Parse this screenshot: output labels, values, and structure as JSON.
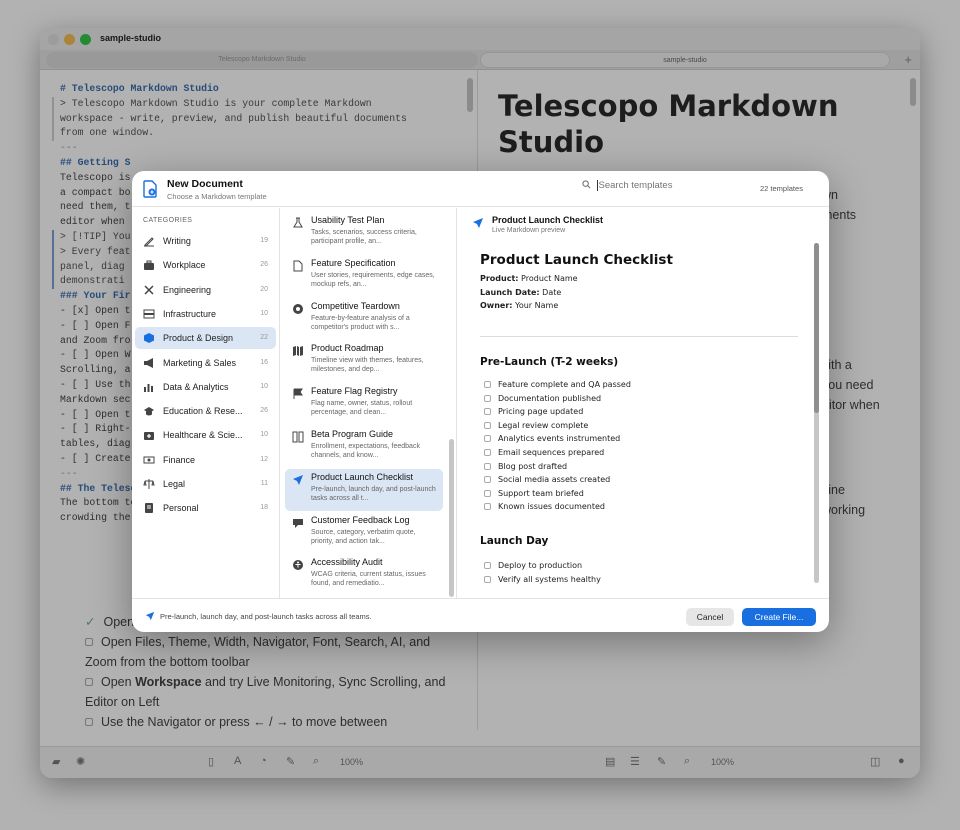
{
  "window": {
    "title": "sample-studio",
    "tabs": [
      {
        "label": "Telescopo Markdown Studio"
      },
      {
        "label": "sample-studio"
      }
    ]
  },
  "editor": {
    "lines": [
      "# Telescopo Markdown Studio",
      "",
      "> Telescopo Markdown Studio is your complete Markdown",
      "workspace - write, preview, and publish beautiful documents",
      "from one window.",
      "",
      "---",
      "",
      "## Getting S",
      "",
      "Telescopo is",
      "a compact bo",
      "need them, t",
      "editor when",
      "",
      "> [!TIP] You",
      "> Every feat",
      "panel, diag",
      "demonstrati",
      "",
      "### Your Fir",
      "",
      "- [x] Open t",
      "- [ ] Open F",
      "and Zoom fro",
      "- [ ] Open W",
      "Scrolling, a",
      "- [ ] Use th",
      "Markdown sec",
      "- [ ] Open t",
      "- [ ] Right-",
      "tables, diag",
      "- [ ] Create",
      "",
      "---",
      "",
      "## The Telescopo Bottom Toolbar",
      "",
      "The bottom toolbar keeps document tools visible without",
      "crowding the reading surface."
    ]
  },
  "preview": {
    "heading": "Telescopo Markdown Studio",
    "fragments": [
      "wn",
      "ments",
      "vith a",
      "you need",
      "ditor when",
      "tline",
      "working"
    ],
    "checklist": [
      {
        "checked": true,
        "text": "Open this guide"
      },
      {
        "checked": false,
        "text": "Open Files, Theme, Width, Navigator, Font, Search, AI, and Zoom from the bottom toolbar"
      },
      {
        "checked": false,
        "text_before": "Open ",
        "bold": "Workspace",
        "text_after": " and try Live Monitoring, Sync Scrolling, and Editor on Left"
      },
      {
        "checked": false,
        "text": "Use the Navigator or press ← / → to move between"
      }
    ]
  },
  "bottombar": {
    "left_zoom": "100%",
    "right_zoom": "100%"
  },
  "modal": {
    "title": "New Document",
    "subtitle": "Choose a Markdown template",
    "search_placeholder": "Search templates",
    "count": "22 templates",
    "categories_heading": "CATEGORIES",
    "categories": [
      {
        "label": "Writing",
        "count": "19",
        "icon": "pen-icon"
      },
      {
        "label": "Workplace",
        "count": "26",
        "icon": "briefcase-icon"
      },
      {
        "label": "Engineering",
        "count": "20",
        "icon": "wrench-icon"
      },
      {
        "label": "Infrastructure",
        "count": "10",
        "icon": "server-icon"
      },
      {
        "label": "Product & Design",
        "count": "22",
        "icon": "cube-icon"
      },
      {
        "label": "Marketing & Sales",
        "count": "16",
        "icon": "megaphone-icon"
      },
      {
        "label": "Data & Analytics",
        "count": "10",
        "icon": "bar-chart-icon"
      },
      {
        "label": "Education & Rese...",
        "count": "26",
        "icon": "graduation-cap-icon"
      },
      {
        "label": "Healthcare & Scie...",
        "count": "10",
        "icon": "medical-kit-icon"
      },
      {
        "label": "Finance",
        "count": "12",
        "icon": "banknote-icon"
      },
      {
        "label": "Legal",
        "count": "11",
        "icon": "scales-icon"
      },
      {
        "label": "Personal",
        "count": "18",
        "icon": "notebook-icon"
      }
    ],
    "selected_category": "Product & Design",
    "templates": [
      {
        "title": "Usability Test Plan",
        "desc": "Tasks, scenarios, success criteria, participant profile, an...",
        "icon": "flask-icon"
      },
      {
        "title": "Feature Specification",
        "desc": "User stories, requirements, edge cases, mockup refs, an...",
        "icon": "doc-icon"
      },
      {
        "title": "Competitive Teardown",
        "desc": "Feature-by-feature analysis of a competitor's product with s...",
        "icon": "target-icon"
      },
      {
        "title": "Product Roadmap",
        "desc": "Timeline view with themes, features, milestones, and dep...",
        "icon": "map-icon"
      },
      {
        "title": "Feature Flag Registry",
        "desc": "Flag name, owner, status, rollout percentage, and clean...",
        "icon": "flag-icon"
      },
      {
        "title": "Beta Program Guide",
        "desc": "Enrollment, expectations, feedback channels, and know...",
        "icon": "book-icon"
      },
      {
        "title": "Product Launch Checklist",
        "desc": "Pre-launch, launch day, and post-launch tasks across all t...",
        "icon": "paper-plane-icon"
      },
      {
        "title": "Customer Feedback Log",
        "desc": "Source, category, verbatim quote, priority, and action tak...",
        "icon": "chat-icon"
      },
      {
        "title": "Accessibility Audit",
        "desc": "WCAG criteria, current status, issues found, and remediatio...",
        "icon": "accessibility-icon"
      }
    ],
    "selected_template": "Product Launch Checklist",
    "preview_header": {
      "title": "Product Launch Checklist",
      "subtitle": "Live Markdown preview"
    },
    "preview_doc": {
      "title": "Product Launch Checklist",
      "meta": [
        {
          "key": "Product:",
          "value": " Product Name"
        },
        {
          "key": "Launch Date:",
          "value": " Date"
        },
        {
          "key": "Owner:",
          "value": " Your Name"
        }
      ],
      "section1": "Pre-Launch (T-2 weeks)",
      "section1_items": [
        "Feature complete and QA passed",
        "Documentation published",
        "Pricing page updated",
        "Legal review complete",
        "Analytics events instrumented",
        "Email sequences prepared",
        "Blog post drafted",
        "Social media assets created",
        "Support team briefed",
        "Known issues documented"
      ],
      "section2": "Launch Day",
      "section2_items": [
        "Deploy to production",
        "Verify all systems healthy"
      ]
    },
    "footer_text": "Pre-launch, launch day, and post-launch tasks across all teams.",
    "cancel_label": "Cancel",
    "create_label": "Create File..."
  }
}
